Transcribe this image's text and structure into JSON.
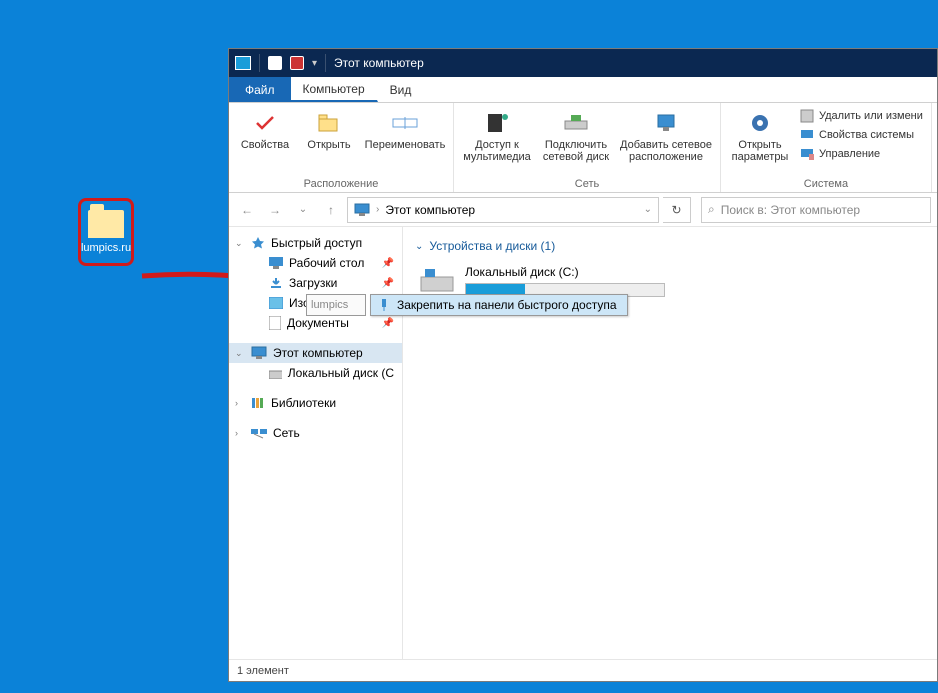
{
  "desktop": {
    "icon_label": "lumpics.ru"
  },
  "titlebar": {
    "title": "Этот компьютер"
  },
  "tabs": {
    "file": "Файл",
    "computer": "Компьютер",
    "view": "Вид"
  },
  "ribbon": {
    "location": {
      "properties": "Свойства",
      "open": "Открыть",
      "rename": "Переименовать",
      "group": "Расположение"
    },
    "network": {
      "media_access": "Доступ к мультимедиа",
      "map_drive": "Подключить сетевой диск",
      "add_network": "Добавить сетевое расположение",
      "group": "Сеть"
    },
    "system": {
      "open_settings": "Открыть параметры",
      "uninstall": "Удалить или измени",
      "sys_props": "Свойства системы",
      "manage": "Управление",
      "group": "Система"
    }
  },
  "addressbar": {
    "path": "Этот компьютер"
  },
  "search": {
    "placeholder": "Поиск в: Этот компьютер"
  },
  "sidebar": {
    "quick_access": "Быстрый доступ",
    "desktop": "Рабочий стол",
    "downloads": "Загрузки",
    "pictures": "Изображения",
    "documents": "Документы",
    "this_pc": "Этот компьютер",
    "local_disk": "Локальный диск (С",
    "libraries": "Библиотеки",
    "network": "Сеть"
  },
  "content": {
    "section": "Устройства и диски (1)",
    "drive_name": "Локальный диск (С:)"
  },
  "drag_ghost": "lumpics",
  "context_menu": {
    "pin": "Закрепить на панели быстрого доступа"
  },
  "status": {
    "text": "1 элемент"
  }
}
